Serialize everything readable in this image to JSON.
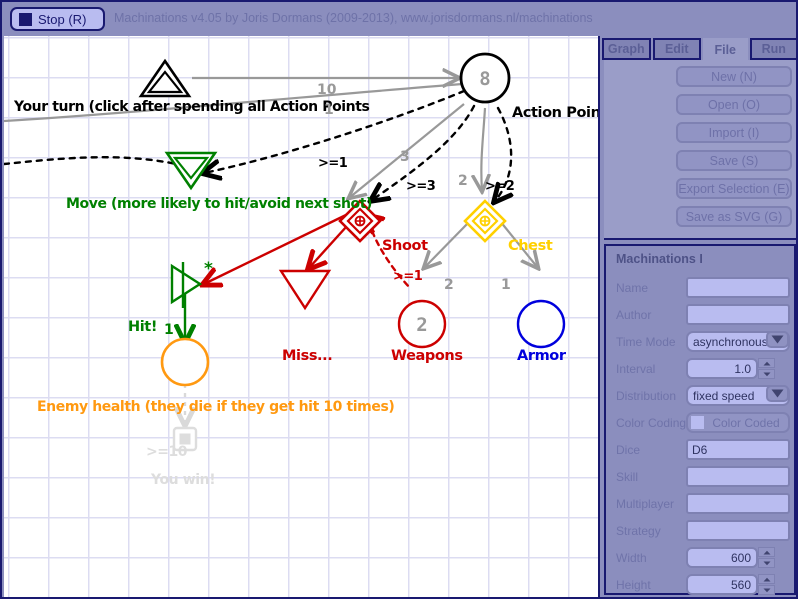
{
  "window": {
    "title": "Machinations v4.05 by Joris Dormans (2009-2013), www.jorisdormans.nl/machinations",
    "stop_button_label": "Stop (R)",
    "accent_color": "#191970",
    "panel_color": "#8b8ebe",
    "field_color": "#b9bcf0"
  },
  "tabs": [
    {
      "label": "Graph",
      "active": false
    },
    {
      "label": "Edit",
      "active": false
    },
    {
      "label": "File",
      "active": true
    },
    {
      "label": "Run",
      "active": false
    }
  ],
  "file_buttons": [
    {
      "label": "New (N)"
    },
    {
      "label": "Open (O)"
    },
    {
      "label": "Import (I)"
    },
    {
      "label": "Save (S)"
    },
    {
      "label": "Export Selection (E)"
    },
    {
      "label": "Save as SVG (G)"
    }
  ],
  "properties": {
    "title": "Machinations I",
    "rows": [
      {
        "label": "Name",
        "value": "",
        "type": "text"
      },
      {
        "label": "Author",
        "value": "",
        "type": "text"
      },
      {
        "label": "Time Mode",
        "value": "asynchronous",
        "type": "select"
      },
      {
        "label": "Interval",
        "value": "1.0",
        "type": "number"
      },
      {
        "label": "Distribution",
        "value": "fixed speed",
        "type": "select"
      },
      {
        "label": "Color Coding",
        "value": "Color Coded",
        "type": "checkbox",
        "checked": false
      },
      {
        "label": "Dice",
        "value": "D6",
        "type": "text"
      },
      {
        "label": "Skill",
        "value": "",
        "type": "text"
      },
      {
        "label": "Multiplayer",
        "value": "",
        "type": "text"
      },
      {
        "label": "Strategy",
        "value": "",
        "type": "text"
      },
      {
        "label": "Width",
        "value": "600",
        "type": "number"
      },
      {
        "label": "Height",
        "value": "560",
        "type": "number"
      }
    ]
  },
  "diagram": {
    "nodes": {
      "your_turn_label": "Your turn (click after spending all Action Points",
      "move_label": "Move (more likely to hit/avoid next shot)",
      "action_points_label": "Action Points",
      "action_points_value": "8",
      "shoot_label": "Shoot",
      "chest_label": "Chest",
      "hit_label": "Hit!",
      "miss_label": "Miss...",
      "weapons_label": "Weapons",
      "weapons_value": "2",
      "armor_label": "Armor",
      "enemy_health_label": "Enemy health (they die if they get hit 10 times)",
      "you_win_label": "You win!"
    },
    "edge_labels": {
      "ten": "10",
      "one_top": "1",
      "three": "3",
      "two_mid": "2",
      "two_chest": "2",
      "one_chest": "1",
      "one_hit": "1",
      "ge1_turn": ">=1",
      "ge3_shoot": ">=3",
      "ge2_chest": ">=2",
      "ge1_weapons": ">=1",
      "ge10_win": ">=10"
    },
    "colors": {
      "black": "#000000",
      "green": "#008000",
      "red": "#cc0000",
      "yellow": "#ffd000",
      "orange": "#ff9911",
      "blue": "#0000dd",
      "gray": "#999999",
      "faded": "#dddddd"
    }
  }
}
